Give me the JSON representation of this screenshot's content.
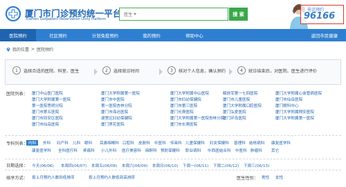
{
  "header": {
    "logo_cn": "厦门市门诊预约统一平台",
    "logo_en": "Xiamen Outpatient Reservation Unity Platform",
    "search_select": "医生",
    "search_button": "搜 索",
    "hotline_label": "电话预约",
    "hotline_number": "96166"
  },
  "nav": {
    "items": [
      {
        "label": "医院预约"
      },
      {
        "label": "社区预约"
      },
      {
        "label": "计划免疫预约"
      },
      {
        "label": "我的预约"
      },
      {
        "label": "帮助中心"
      }
    ],
    "right": "返回市民健康"
  },
  "breadcrumb": {
    "prefix": "我的位置",
    "current": "医院预约"
  },
  "steps": [
    {
      "num": "1",
      "text": "选择合适的医院、科室、医生"
    },
    {
      "num": "2",
      "text": "选择就诊时间"
    },
    {
      "num": "3",
      "text": "核对个人信息，确认预约"
    },
    {
      "num": "4",
      "text": "就诊结束后，对医院、医生进行评价"
    }
  ],
  "hospitals": {
    "label": "医院列表：",
    "items": [
      "厦门中山医门医院",
      "厦门大学附属第一医院",
      "厦门大学附属中山医院",
      "解放军第一七四医院",
      "厦门大学附属心血管病医院",
      "厦门大学附属第一医院",
      "厦门市中医院",
      "厦门市妇幼保健院",
      "厦门市儿童医院",
      "厦门市仙岳医院",
      "第一医院思明分院",
      "第一医院杏林分院",
      "厦门市第三医院",
      "厦门大学附属口腔医院",
      "厦门眼科中心",
      "厦门市第五医院",
      "厦门市海沧医院",
      "厦门长庚医院",
      "厦门弘爱医院",
      "厦门大学附属翔安医院",
      "厦门市同安区医院",
      "湖里区妇幼保健院",
      "厦门大学附属第一医院杏林分院",
      "厦门环岛医院",
      "厦门大学附属第一医院",
      "厦门市仙岳医院",
      "厦门莲花医院",
      "厦门市长庚医院"
    ]
  },
  "departments": {
    "label": "专科列表：",
    "row1": [
      "内科",
      "外科",
      "妇产科",
      "儿科",
      "眼科",
      "耳鼻咽喉科",
      "口腔科",
      "皮肤科",
      "中医科",
      "传染科",
      "儿童保健科",
      "妇女保健科",
      "普理科",
      "结核病科",
      "康复医学科"
    ],
    "row2": [
      "康复医学科",
      "全科医疗科",
      "疼痛科",
      "小儿外科",
      "医疗美容科",
      "麻醉科",
      "预防保健科",
      "职业病科",
      "中西医结合科",
      "中医科",
      "肿瘤科",
      "其它"
    ]
  },
  "dates": {
    "label": "日期选择：",
    "items": [
      "今天(06/06)",
      "本周四(06/07)",
      "本周五(06/08)",
      "本周六(06/09)",
      "本周日(06/10)",
      "下周一(06/11)",
      "下周二(06/12)",
      "下周三(06/13)"
    ]
  },
  "sort": {
    "label": "排序方式：",
    "options": [
      "按上月预约人数到低排序",
      "按上月预约人数低到高排序"
    ],
    "gender_label": "医生性别：",
    "gender_options": [
      "男性",
      "女性"
    ]
  },
  "colors": {
    "brand_blue": "#2e7fd1",
    "link_blue": "#1f63b0",
    "search_green": "#3aa84a",
    "hotline_red": "#d9382d"
  }
}
